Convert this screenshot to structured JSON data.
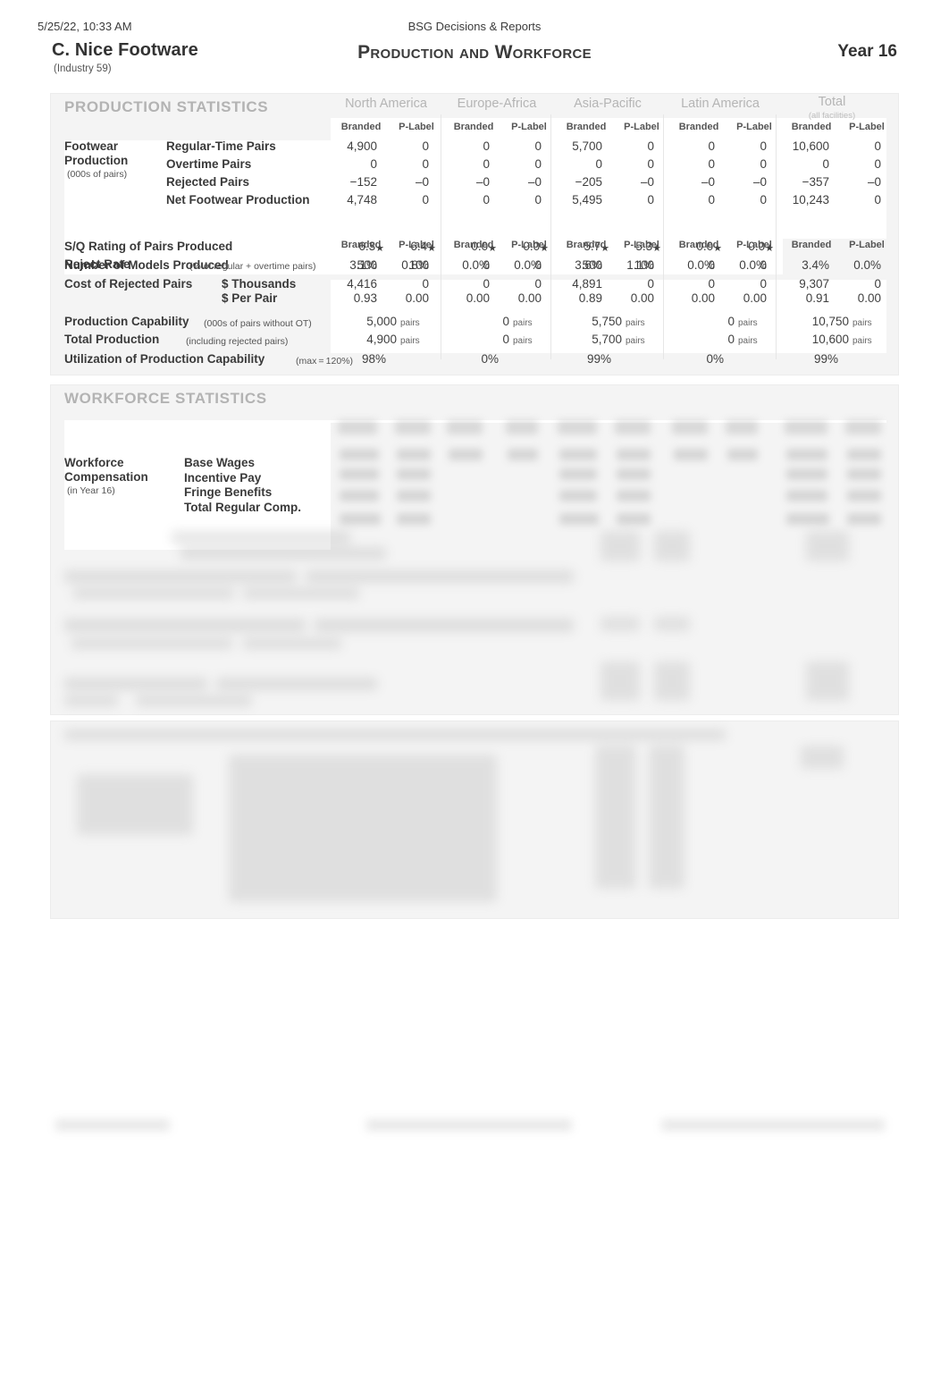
{
  "browser_header": {
    "timestamp": "5/25/22, 10:33 AM",
    "doc_title": "BSG Decisions & Reports"
  },
  "report": {
    "company": "C. Nice Footware",
    "industry": "(Industry 59)",
    "title": "Production and Workforce",
    "year": "Year 16"
  },
  "regions": [
    {
      "name": "North America",
      "sub": ""
    },
    {
      "name": "Europe-Africa",
      "sub": ""
    },
    {
      "name": "Asia-Pacific",
      "sub": ""
    },
    {
      "name": "Latin America",
      "sub": ""
    },
    {
      "name": "Total",
      "sub": "(all facilities)"
    }
  ],
  "column_headers": {
    "branded": "Branded",
    "plabel": "P-Label"
  },
  "production": {
    "section_title": "PRODUCTION STATISTICS",
    "group_label_line1": "Footwear",
    "group_label_line2": "Production",
    "group_label_note": "(000s of pairs)",
    "rows": [
      {
        "label": "Regular-Time Pairs",
        "values": [
          "4,900",
          "0",
          "0",
          "0",
          "5,700",
          "0",
          "0",
          "0",
          "10,600",
          "0"
        ]
      },
      {
        "label": "Overtime Pairs",
        "values": [
          "0",
          "0",
          "0",
          "0",
          "0",
          "0",
          "0",
          "0",
          "0",
          "0"
        ]
      },
      {
        "label": "Rejected Pairs",
        "values": [
          "−152",
          "‒0",
          "‒0",
          "‒0",
          "−205",
          "‒0",
          "‒0",
          "‒0",
          "−357",
          "‒0"
        ]
      },
      {
        "label": "Net Footwear Production",
        "values": [
          "4,748",
          "0",
          "0",
          "0",
          "5,495",
          "0",
          "0",
          "0",
          "10,243",
          "0"
        ]
      }
    ],
    "sq_rating": {
      "label": "S/Q Rating of Pairs Produced",
      "values": [
        "6.3",
        "6.4",
        "0.0",
        "0.0",
        "5.7",
        "5.3",
        "0.0",
        "0.0",
        "",
        ""
      ],
      "star": "★"
    },
    "models": {
      "label": "Number of Models Produced",
      "values": [
        "500",
        "100",
        "0",
        "0",
        "500",
        "100",
        "0",
        "0",
        "",
        ""
      ]
    },
    "reject_rate": {
      "label": "Reject Rate",
      "note": "(% of regular + overtime pairs)",
      "values": [
        "3.1%",
        "0.8%",
        "0.0%",
        "0.0%",
        "3.6%",
        "1.1%",
        "0.0%",
        "0.0%",
        "3.4%",
        "0.0%"
      ]
    },
    "cost_rejected": {
      "label": "Cost of Rejected Pairs",
      "sub_thousands": "$ Thousands",
      "sub_per_pair": "$ Per Pair",
      "thousands": [
        "4,416",
        "0",
        "0",
        "0",
        "4,891",
        "0",
        "0",
        "0",
        "9,307",
        "0"
      ],
      "per_pair": [
        "0.93",
        "0.00",
        "0.00",
        "0.00",
        "0.89",
        "0.00",
        "0.00",
        "0.00",
        "0.91",
        "0.00"
      ]
    },
    "capability": {
      "label": "Production Capability",
      "note": "(000s of pairs without OT)",
      "unit": "pairs",
      "values": [
        "5,000",
        "0",
        "5,750",
        "0",
        "10,750"
      ]
    },
    "total_production": {
      "label": "Total Production",
      "note": "(including rejected pairs)",
      "unit": "pairs",
      "values": [
        "4,900",
        "0",
        "5,700",
        "0",
        "10,600"
      ]
    },
    "utilization": {
      "label": "Utilization of Production Capability",
      "note": "(max = 120%)",
      "values": [
        "98%",
        "0%",
        "99%",
        "0%",
        "99%"
      ]
    }
  },
  "workforce": {
    "section_title": "WORKFORCE STATISTICS",
    "group_label_line1": "Workforce",
    "group_label_line2": "Compensation",
    "group_label_note": "(in Year 16)",
    "rows": [
      {
        "label": "Base Wages"
      },
      {
        "label": "Incentive Pay"
      },
      {
        "label": "Fringe Benefits"
      },
      {
        "label": "Total Regular Comp."
      }
    ]
  }
}
